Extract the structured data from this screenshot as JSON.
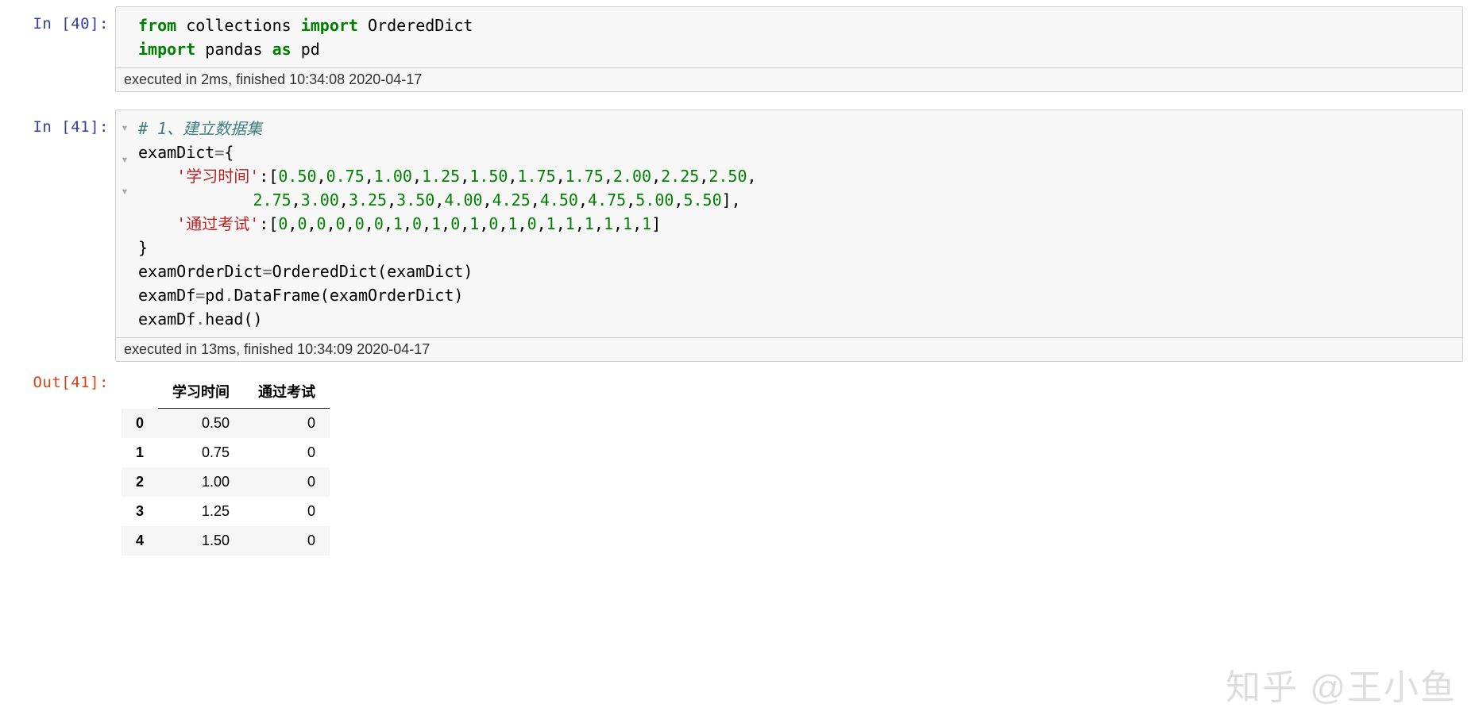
{
  "cells": [
    {
      "prompt_type": "In",
      "prompt_num": "40",
      "prompt_text": "In [40]:",
      "code_tokens": [
        [
          {
            "t": "from ",
            "c": "kw-green"
          },
          {
            "t": "collections ",
            "c": ""
          },
          {
            "t": "import ",
            "c": "kw-green"
          },
          {
            "t": "OrderedDict",
            "c": ""
          }
        ],
        [
          {
            "t": "import ",
            "c": "kw-green"
          },
          {
            "t": "pandas ",
            "c": ""
          },
          {
            "t": "as ",
            "c": "kw-green"
          },
          {
            "t": "pd",
            "c": ""
          }
        ]
      ],
      "folds": [],
      "timing": "executed in 2ms, finished 10:34:08 2020-04-17"
    },
    {
      "prompt_type": "In",
      "prompt_num": "41",
      "prompt_text": "In [41]:",
      "code_tokens": [
        [
          {
            "t": "# 1、建立数据集",
            "c": "comment"
          }
        ],
        [
          {
            "t": "examDict",
            "c": ""
          },
          {
            "t": "=",
            "c": "op"
          },
          {
            "t": "{",
            "c": ""
          }
        ],
        [
          {
            "t": "    ",
            "c": ""
          },
          {
            "t": "'学习时间'",
            "c": "str-red"
          },
          {
            "t": ":[",
            "c": ""
          },
          {
            "t": "0.50",
            "c": "num-green"
          },
          {
            "t": ",",
            "c": ""
          },
          {
            "t": "0.75",
            "c": "num-green"
          },
          {
            "t": ",",
            "c": ""
          },
          {
            "t": "1.00",
            "c": "num-green"
          },
          {
            "t": ",",
            "c": ""
          },
          {
            "t": "1.25",
            "c": "num-green"
          },
          {
            "t": ",",
            "c": ""
          },
          {
            "t": "1.50",
            "c": "num-green"
          },
          {
            "t": ",",
            "c": ""
          },
          {
            "t": "1.75",
            "c": "num-green"
          },
          {
            "t": ",",
            "c": ""
          },
          {
            "t": "1.75",
            "c": "num-green"
          },
          {
            "t": ",",
            "c": ""
          },
          {
            "t": "2.00",
            "c": "num-green"
          },
          {
            "t": ",",
            "c": ""
          },
          {
            "t": "2.25",
            "c": "num-green"
          },
          {
            "t": ",",
            "c": ""
          },
          {
            "t": "2.50",
            "c": "num-green"
          },
          {
            "t": ",",
            "c": ""
          }
        ],
        [
          {
            "t": "            ",
            "c": ""
          },
          {
            "t": "2.75",
            "c": "num-green"
          },
          {
            "t": ",",
            "c": ""
          },
          {
            "t": "3.00",
            "c": "num-green"
          },
          {
            "t": ",",
            "c": ""
          },
          {
            "t": "3.25",
            "c": "num-green"
          },
          {
            "t": ",",
            "c": ""
          },
          {
            "t": "3.50",
            "c": "num-green"
          },
          {
            "t": ",",
            "c": ""
          },
          {
            "t": "4.00",
            "c": "num-green"
          },
          {
            "t": ",",
            "c": ""
          },
          {
            "t": "4.25",
            "c": "num-green"
          },
          {
            "t": ",",
            "c": ""
          },
          {
            "t": "4.50",
            "c": "num-green"
          },
          {
            "t": ",",
            "c": ""
          },
          {
            "t": "4.75",
            "c": "num-green"
          },
          {
            "t": ",",
            "c": ""
          },
          {
            "t": "5.00",
            "c": "num-green"
          },
          {
            "t": ",",
            "c": ""
          },
          {
            "t": "5.50",
            "c": "num-green"
          },
          {
            "t": "],",
            "c": ""
          }
        ],
        [
          {
            "t": "    ",
            "c": ""
          },
          {
            "t": "'通过考试'",
            "c": "str-red"
          },
          {
            "t": ":[",
            "c": ""
          },
          {
            "t": "0",
            "c": "num-green"
          },
          {
            "t": ",",
            "c": ""
          },
          {
            "t": "0",
            "c": "num-green"
          },
          {
            "t": ",",
            "c": ""
          },
          {
            "t": "0",
            "c": "num-green"
          },
          {
            "t": ",",
            "c": ""
          },
          {
            "t": "0",
            "c": "num-green"
          },
          {
            "t": ",",
            "c": ""
          },
          {
            "t": "0",
            "c": "num-green"
          },
          {
            "t": ",",
            "c": ""
          },
          {
            "t": "0",
            "c": "num-green"
          },
          {
            "t": ",",
            "c": ""
          },
          {
            "t": "1",
            "c": "num-green"
          },
          {
            "t": ",",
            "c": ""
          },
          {
            "t": "0",
            "c": "num-green"
          },
          {
            "t": ",",
            "c": ""
          },
          {
            "t": "1",
            "c": "num-green"
          },
          {
            "t": ",",
            "c": ""
          },
          {
            "t": "0",
            "c": "num-green"
          },
          {
            "t": ",",
            "c": ""
          },
          {
            "t": "1",
            "c": "num-green"
          },
          {
            "t": ",",
            "c": ""
          },
          {
            "t": "0",
            "c": "num-green"
          },
          {
            "t": ",",
            "c": ""
          },
          {
            "t": "1",
            "c": "num-green"
          },
          {
            "t": ",",
            "c": ""
          },
          {
            "t": "0",
            "c": "num-green"
          },
          {
            "t": ",",
            "c": ""
          },
          {
            "t": "1",
            "c": "num-green"
          },
          {
            "t": ",",
            "c": ""
          },
          {
            "t": "1",
            "c": "num-green"
          },
          {
            "t": ",",
            "c": ""
          },
          {
            "t": "1",
            "c": "num-green"
          },
          {
            "t": ",",
            "c": ""
          },
          {
            "t": "1",
            "c": "num-green"
          },
          {
            "t": ",",
            "c": ""
          },
          {
            "t": "1",
            "c": "num-green"
          },
          {
            "t": ",",
            "c": ""
          },
          {
            "t": "1",
            "c": "num-green"
          },
          {
            "t": "]",
            "c": ""
          }
        ],
        [
          {
            "t": "}",
            "c": ""
          }
        ],
        [
          {
            "t": "examOrderDict",
            "c": ""
          },
          {
            "t": "=",
            "c": "op"
          },
          {
            "t": "OrderedDict(examDict)",
            "c": ""
          }
        ],
        [
          {
            "t": "examDf",
            "c": ""
          },
          {
            "t": "=",
            "c": "op"
          },
          {
            "t": "pd",
            "c": ""
          },
          {
            "t": ".",
            "c": "op"
          },
          {
            "t": "DataFrame(examOrderDict)",
            "c": ""
          }
        ],
        [
          {
            "t": "examDf",
            "c": ""
          },
          {
            "t": ".",
            "c": "op"
          },
          {
            "t": "head()",
            "c": ""
          }
        ]
      ],
      "folds": [
        "▾",
        "▾",
        "▾"
      ],
      "timing": "executed in 13ms, finished 10:34:09 2020-04-17"
    }
  ],
  "output": {
    "prompt_text": "Out[41]:",
    "table": {
      "columns": [
        "",
        "学习时间",
        "通过考试"
      ],
      "rows": [
        [
          "0",
          "0.50",
          "0"
        ],
        [
          "1",
          "0.75",
          "0"
        ],
        [
          "2",
          "1.00",
          "0"
        ],
        [
          "3",
          "1.25",
          "0"
        ],
        [
          "4",
          "1.50",
          "0"
        ]
      ]
    }
  },
  "watermark": "知乎 @王小鱼",
  "chart_data": {
    "type": "table",
    "title": "examDf.head()",
    "columns": [
      "学习时间",
      "通过考试"
    ],
    "index": [
      0,
      1,
      2,
      3,
      4
    ],
    "rows": [
      [
        0.5,
        0
      ],
      [
        0.75,
        0
      ],
      [
        1.0,
        0
      ],
      [
        1.25,
        0
      ],
      [
        1.5,
        0
      ]
    ]
  }
}
